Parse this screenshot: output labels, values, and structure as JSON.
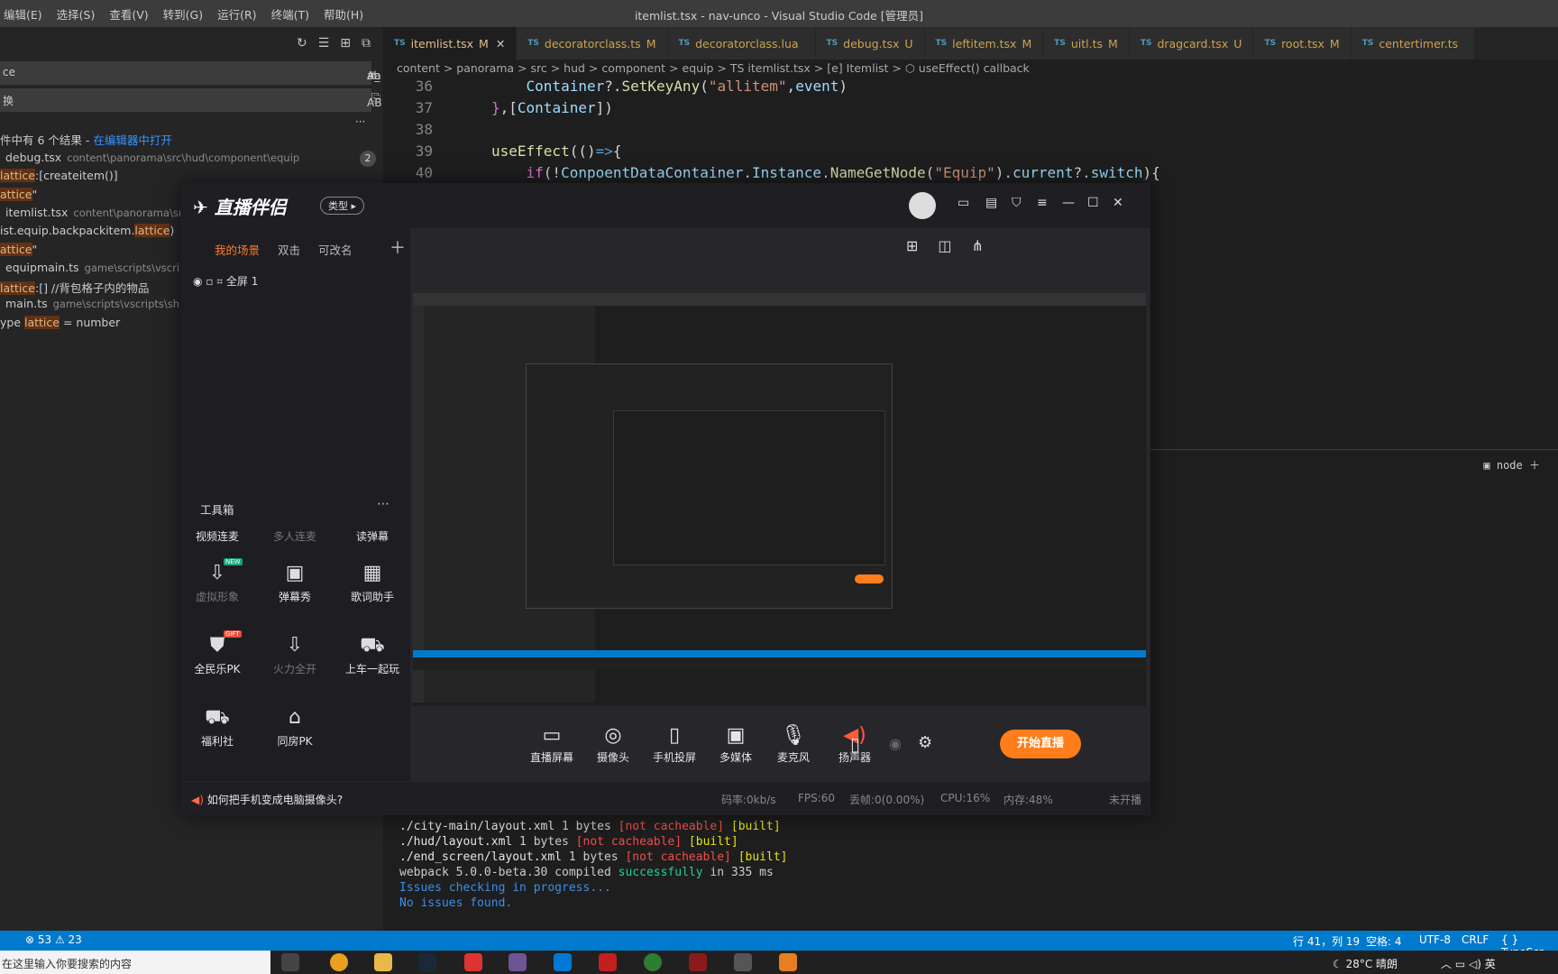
{
  "vscode": {
    "menu": [
      "编辑(E)",
      "选择(S)",
      "查看(V)",
      "转到(G)",
      "运行(R)",
      "终端(T)",
      "帮助(H)"
    ],
    "window_title": "itemlist.tsx - nav-unco - Visual Studio Code [管理员]",
    "search": {
      "query": "ce",
      "replace": "换",
      "summary": "件中有 6 个结果 - ",
      "open_link": "在编辑器中打开",
      "results": [
        {
          "file": "debug.tsx",
          "path": "content\\panorama\\src\\hud\\component\\equip",
          "count": "2"
        },
        {
          "pre": "",
          "match": "lattice",
          "post": ":[createitem()]"
        },
        {
          "pre": "",
          "match": "attice",
          "post": "\""
        },
        {
          "file": "itemlist.tsx",
          "path": "content\\panorama\\src\\h"
        },
        {
          "pre": "ist.equip.backpackitem.",
          "match": "lattice",
          "post": ")"
        },
        {
          "pre": "",
          "match": "attice",
          "post": "\""
        },
        {
          "file": "equipmain.ts",
          "path": "game\\scripts\\vscripts\\"
        },
        {
          "pre": "",
          "match": "lattice",
          "post": ":[] //背包格子内的物品"
        },
        {
          "file": "main.ts",
          "path": "game\\scripts\\vscripts\\shiphc"
        },
        {
          "pre": "ype ",
          "match": "lattice",
          "post": " = number"
        }
      ]
    },
    "tabs": [
      {
        "name": "itemlist.tsx",
        "status": "M",
        "active": true
      },
      {
        "name": "decoratorclass.ts",
        "status": "M"
      },
      {
        "name": "decoratorclass.lua",
        "status": ""
      },
      {
        "name": "debug.tsx",
        "status": "U"
      },
      {
        "name": "leftitem.tsx",
        "status": "M"
      },
      {
        "name": "uitl.ts",
        "status": "M"
      },
      {
        "name": "dragcard.tsx",
        "status": "U"
      },
      {
        "name": "root.tsx",
        "status": "M"
      },
      {
        "name": "centertimer.ts",
        "status": ""
      }
    ],
    "breadcrumb": "content > panorama > src > hud > component > equip > TS itemlist.tsx > [e] Itemlist > ⬡ useEffect() callback",
    "code": [
      {
        "n": "36",
        "t": "    Container?.SetKeyAny(\"allitem\",event)"
      },
      {
        "n": "37",
        "t": "},[Container])"
      },
      {
        "n": "38",
        "t": ""
      },
      {
        "n": "39",
        "t": "useEffect(()=>{"
      },
      {
        "n": "40",
        "t": "    if(!ConpoentDataContainer.Instance.NameGetNode(\"Equip\").current?.switch){"
      }
    ],
    "terminal": {
      "tab": "node",
      "lines": [
        {
          "a": "./city-main/layout.xml",
          "b": " 1 bytes ",
          "c": "[not cacheable]",
          "d": " [built]"
        },
        {
          "a": "./hud/layout.xml",
          "b": " 1 bytes ",
          "c": "[not cacheable]",
          "d": " [built]"
        },
        {
          "a": "./end_screen/layout.xml",
          "b": " 1 bytes ",
          "c": "[not cacheable]",
          "d": " [built]"
        }
      ],
      "compiled_pre": "webpack 5.0.0-beta.30 compiled ",
      "compiled_ok": "successfully",
      "compiled_post": " in 335 ms",
      "checking": "Issues checking in progress...",
      "no_issues": "No issues found."
    },
    "status": {
      "errors": "⊗ 53",
      "warnings": "⚠ 23",
      "position": "行 41，列 19",
      "spaces": "空格: 4",
      "encoding": "UTF-8",
      "eol": "CRLF",
      "language": "{ } TypeScr"
    }
  },
  "taskbar": {
    "search_placeholder": "在这里输入你要搜索的内容",
    "weather": "28°C 晴朗",
    "ime": "英"
  },
  "app": {
    "logo": "直播伴侣",
    "type_label": "类型",
    "scene_tabs": [
      "我的场景",
      "双击",
      "可改名"
    ],
    "scene_item": "全屏 1",
    "toolbox_title": "工具箱",
    "tools": [
      {
        "label": "视频连麦",
        "dim": false
      },
      {
        "label": "多人连麦",
        "dim": true
      },
      {
        "label": "读弹幕",
        "dim": false
      },
      {
        "label": "虚拟形象",
        "dim": true,
        "badge": "NEW"
      },
      {
        "label": "弹幕秀",
        "dim": false
      },
      {
        "label": "歌词助手",
        "dim": false
      },
      {
        "label": "全民乐PK",
        "dim": false,
        "badge": "GIFT"
      },
      {
        "label": "火力全开",
        "dim": true
      },
      {
        "label": "上车一起玩",
        "dim": false
      },
      {
        "label": "福利社",
        "dim": false
      },
      {
        "label": "同房PK",
        "dim": false
      }
    ],
    "bottom_buttons": [
      "直播屏幕",
      "摄像头",
      "手机投屏",
      "多媒体",
      "麦克风",
      "扬声器"
    ],
    "start_label": "开始直播",
    "tip": "如何把手机变成电脑摄像头?",
    "stats": [
      "码率:0kb/s",
      "FPS:60",
      "丢帧:0(0.00%)",
      "CPU:16%",
      "内存:48%",
      "未开播"
    ]
  }
}
